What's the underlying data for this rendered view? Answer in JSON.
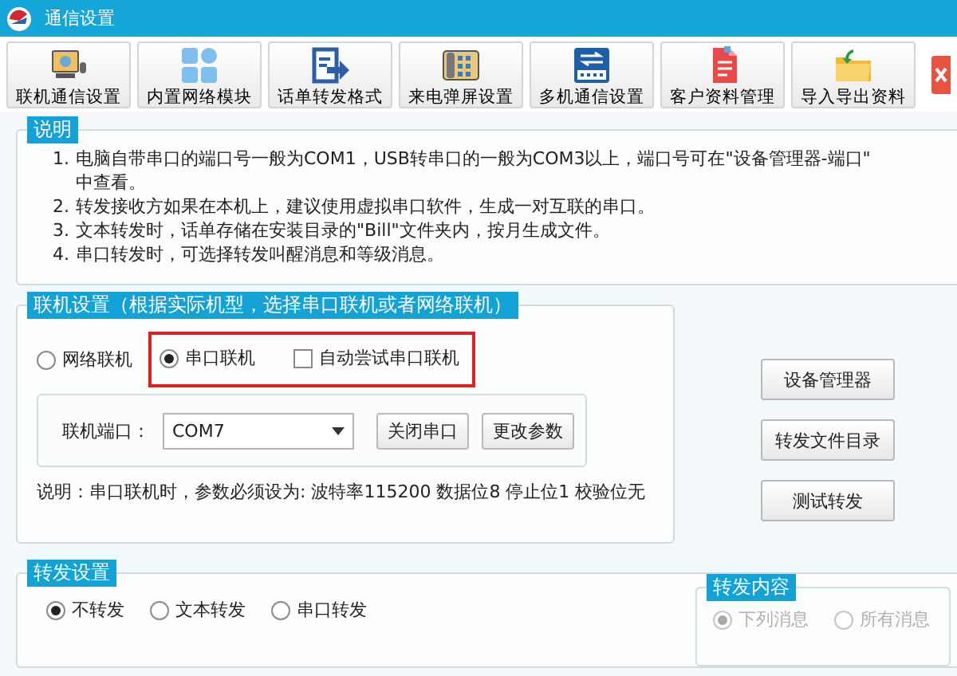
{
  "window": {
    "title": "通信设置"
  },
  "toolbar": [
    {
      "label": "联机通信设置"
    },
    {
      "label": "内置网络模块"
    },
    {
      "label": "话单转发格式"
    },
    {
      "label": "来电弹屏设置"
    },
    {
      "label": "多机通信设置"
    },
    {
      "label": "客户资料管理"
    },
    {
      "label": "导入导出资料"
    }
  ],
  "notes": {
    "title": "说明",
    "items": [
      {
        "number": "1.",
        "text": "电脑自带串口的端口号一般为COM1，USB转串口的一般为COM3以上，端口号可在\"设备管理器-端口\"",
        "continuation": "中查看。"
      },
      {
        "number": "2.",
        "text": "转发接收方如果在本机上，建议使用虚拟串口软件，生成一对互联的串口。"
      },
      {
        "number": "3.",
        "text": "文本转发时，话单存储在安装目录的\"Bill\"文件夹内，按月生成文件。"
      },
      {
        "number": "4.",
        "text": "串口转发时，可选择转发叫醒消息和等级消息。"
      }
    ]
  },
  "connection": {
    "title": "联机设置（根据实际机型，选择串口联机或者网络联机）",
    "modes": [
      {
        "label": "网络联机",
        "selected": false
      },
      {
        "label": "串口联机",
        "selected": true
      }
    ],
    "auto_try": {
      "label": "自动尝试串口联机",
      "checked": false
    },
    "port": {
      "label": "联机端口：",
      "value": "COM7"
    },
    "buttons": [
      "关闭串口",
      "更改参数"
    ],
    "note": "说明：串口联机时，参数必须设为: 波特率115200 数据位8 停止位1 校验位无"
  },
  "side_buttons": [
    "设备管理器",
    "转发文件目录",
    "测试转发"
  ],
  "forward": {
    "title": "转发设置",
    "modes": [
      {
        "label": "不转发",
        "selected": true
      },
      {
        "label": "文本转发",
        "selected": false
      },
      {
        "label": "串口转发",
        "selected": false
      }
    ],
    "content": {
      "title": "转发内容",
      "options": [
        {
          "label": "下列消息",
          "selected": true,
          "disabled": true
        },
        {
          "label": "所有消息",
          "selected": false,
          "disabled": true
        }
      ]
    }
  }
}
